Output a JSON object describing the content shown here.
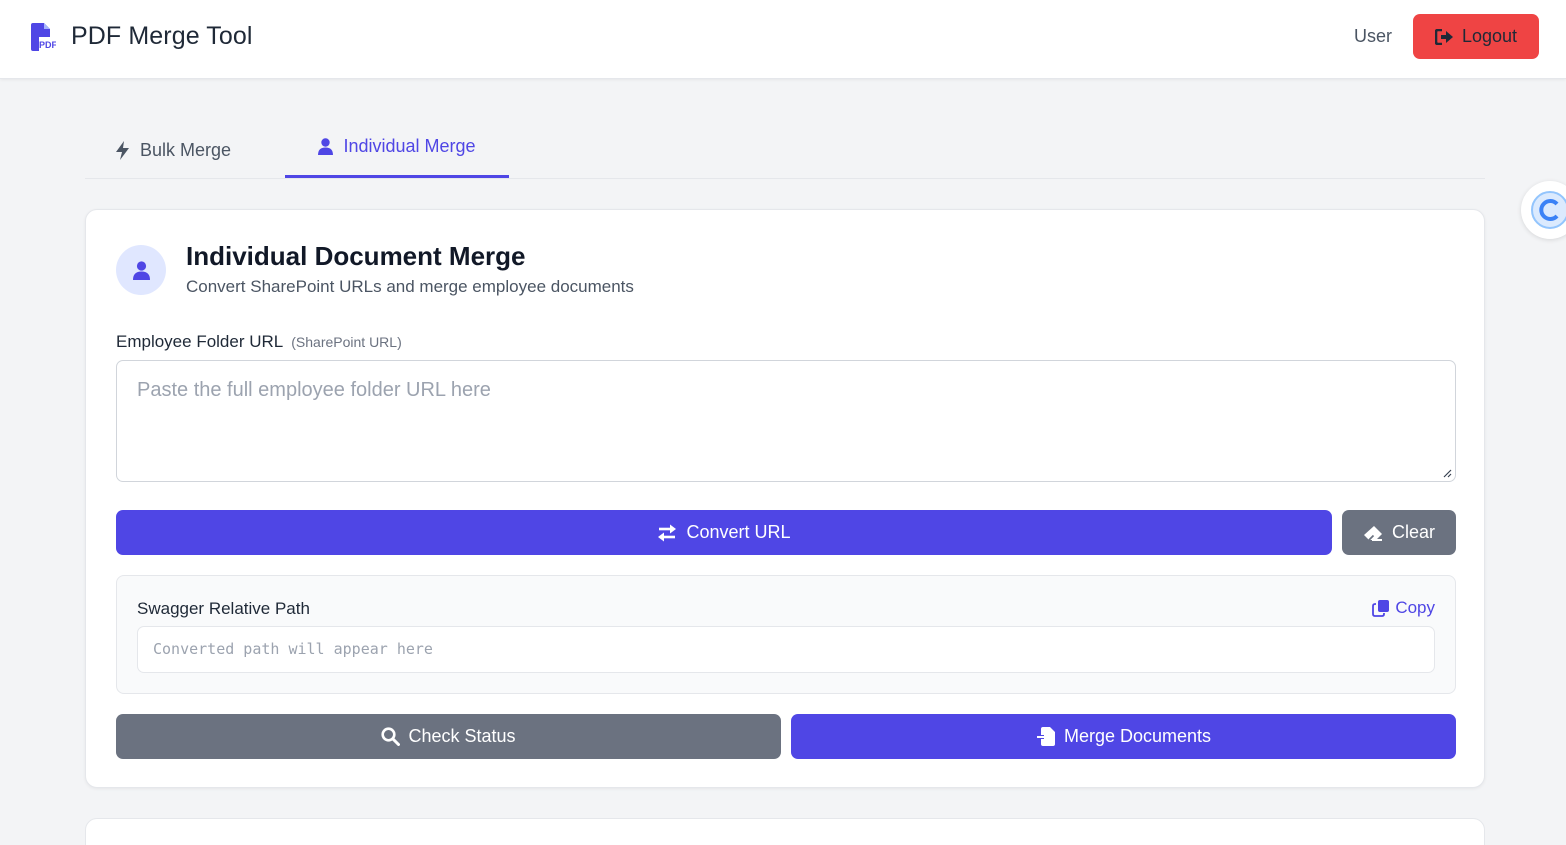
{
  "header": {
    "app_title": "PDF Merge Tool",
    "user_label": "User",
    "logout_label": "Logout",
    "logo_icon": "pdf-file-icon",
    "logout_icon": "sign-out-icon"
  },
  "tabs": [
    {
      "label": "Bulk Merge",
      "icon": "bolt-icon",
      "active": false
    },
    {
      "label": "Individual Merge",
      "icon": "user-icon",
      "active": true
    }
  ],
  "card": {
    "title": "Individual Document Merge",
    "subtitle": "Convert SharePoint URLs and merge employee documents",
    "avatar_icon": "user-icon",
    "employee_folder": {
      "label": "Employee Folder URL",
      "hint": "(SharePoint URL)",
      "value": "",
      "placeholder": "Paste the full employee folder URL here"
    },
    "convert_label": "Convert URL",
    "clear_label": "Clear",
    "swagger": {
      "label": "Swagger Relative Path",
      "copy_label": "Copy",
      "placeholder": "Converted path will appear here"
    },
    "check_status_label": "Check Status",
    "merge_label": "Merge Documents"
  },
  "colors": {
    "accent": "#4f46e5",
    "danger": "#ef4444",
    "neutral_button": "#6b7280",
    "page_background": "#f3f4f6"
  }
}
